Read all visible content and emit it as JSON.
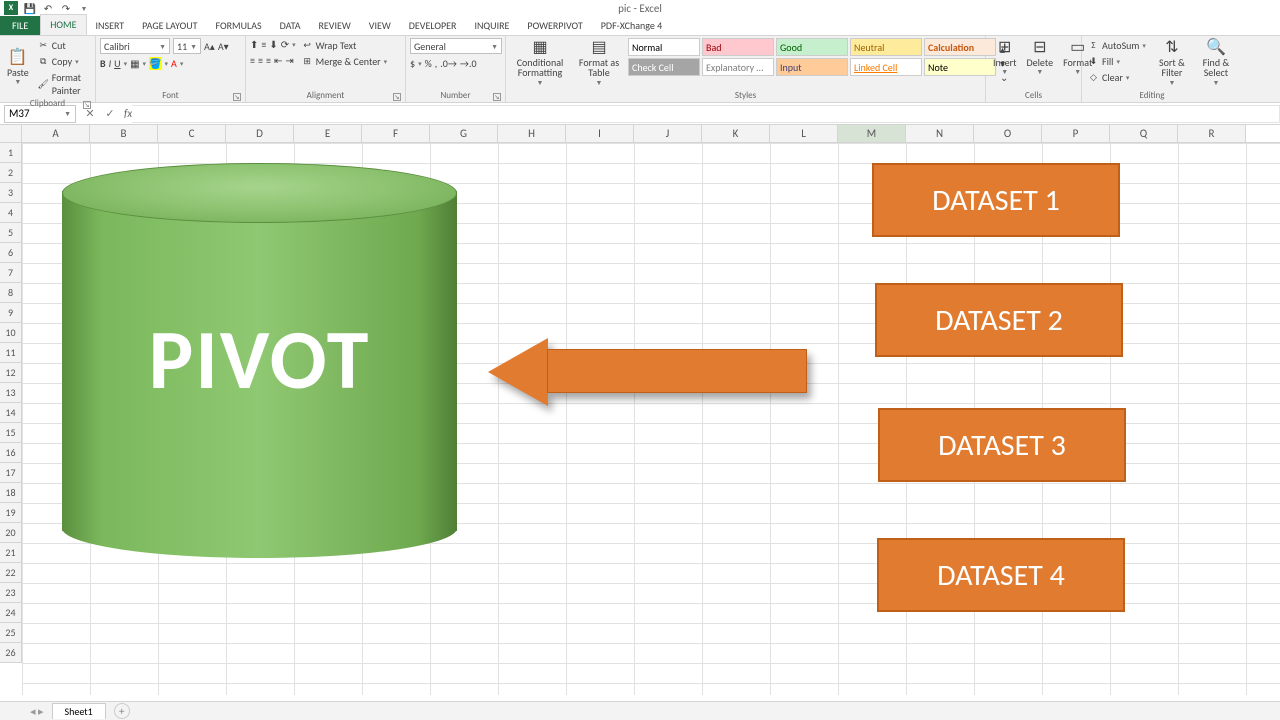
{
  "app": {
    "title": "pic - Excel"
  },
  "qat": {
    "save": "💾",
    "undo": "↶",
    "redo": "↷"
  },
  "tabs": [
    "FILE",
    "HOME",
    "INSERT",
    "PAGE LAYOUT",
    "FORMULAS",
    "DATA",
    "REVIEW",
    "VIEW",
    "DEVELOPER",
    "INQUIRE",
    "POWERPIVOT",
    "PDF-XChange 4"
  ],
  "active_tab": "HOME",
  "clipboard": {
    "paste": "Paste",
    "cut": "Cut",
    "copy": "Copy",
    "painter": "Format Painter",
    "group": "Clipboard"
  },
  "font": {
    "name": "Calibri",
    "size": "11",
    "group": "Font"
  },
  "alignment": {
    "wrap": "Wrap Text",
    "merge": "Merge & Center",
    "group": "Alignment"
  },
  "number": {
    "format": "General",
    "group": "Number"
  },
  "styles_btns": {
    "cond": "Conditional Formatting",
    "table": "Format as Table",
    "group": "Styles"
  },
  "style_cells": [
    {
      "label": "Normal",
      "bg": "#ffffff",
      "color": "#000"
    },
    {
      "label": "Bad",
      "bg": "#ffc7ce",
      "color": "#9c0006"
    },
    {
      "label": "Good",
      "bg": "#c6efce",
      "color": "#006100"
    },
    {
      "label": "Neutral",
      "bg": "#ffeb9c",
      "color": "#9c6500"
    },
    {
      "label": "Calculation",
      "bg": "#fde9d9",
      "color": "#c65911"
    },
    {
      "label": "Check Cell",
      "bg": "#a5a5a5",
      "color": "#fff"
    },
    {
      "label": "Explanatory …",
      "bg": "#ffffff",
      "color": "#7f7f7f"
    },
    {
      "label": "Input",
      "bg": "#ffcc99",
      "color": "#3f3f76"
    },
    {
      "label": "Linked Cell",
      "bg": "#ffffff",
      "color": "#fa7d00"
    },
    {
      "label": "Note",
      "bg": "#ffffcc",
      "color": "#000"
    }
  ],
  "cells_grp": {
    "insert": "Insert",
    "delete": "Delete",
    "format": "Format",
    "group": "Cells"
  },
  "editing": {
    "sum": "AutoSum",
    "fill": "Fill",
    "clear": "Clear",
    "sort": "Sort & Filter",
    "find": "Find & Select",
    "group": "Editing"
  },
  "namebox": "M37",
  "columns": [
    "A",
    "B",
    "C",
    "D",
    "E",
    "F",
    "G",
    "H",
    "I",
    "J",
    "K",
    "L",
    "M",
    "N",
    "O",
    "P",
    "Q",
    "R"
  ],
  "selected_col": "M",
  "row_count": 26,
  "cylinder_label": "PIVOT",
  "datasets": [
    "DATASET 1",
    "DATASET 2",
    "DATASET 3",
    "DATASET 4"
  ],
  "sheet": {
    "name": "Sheet1"
  }
}
